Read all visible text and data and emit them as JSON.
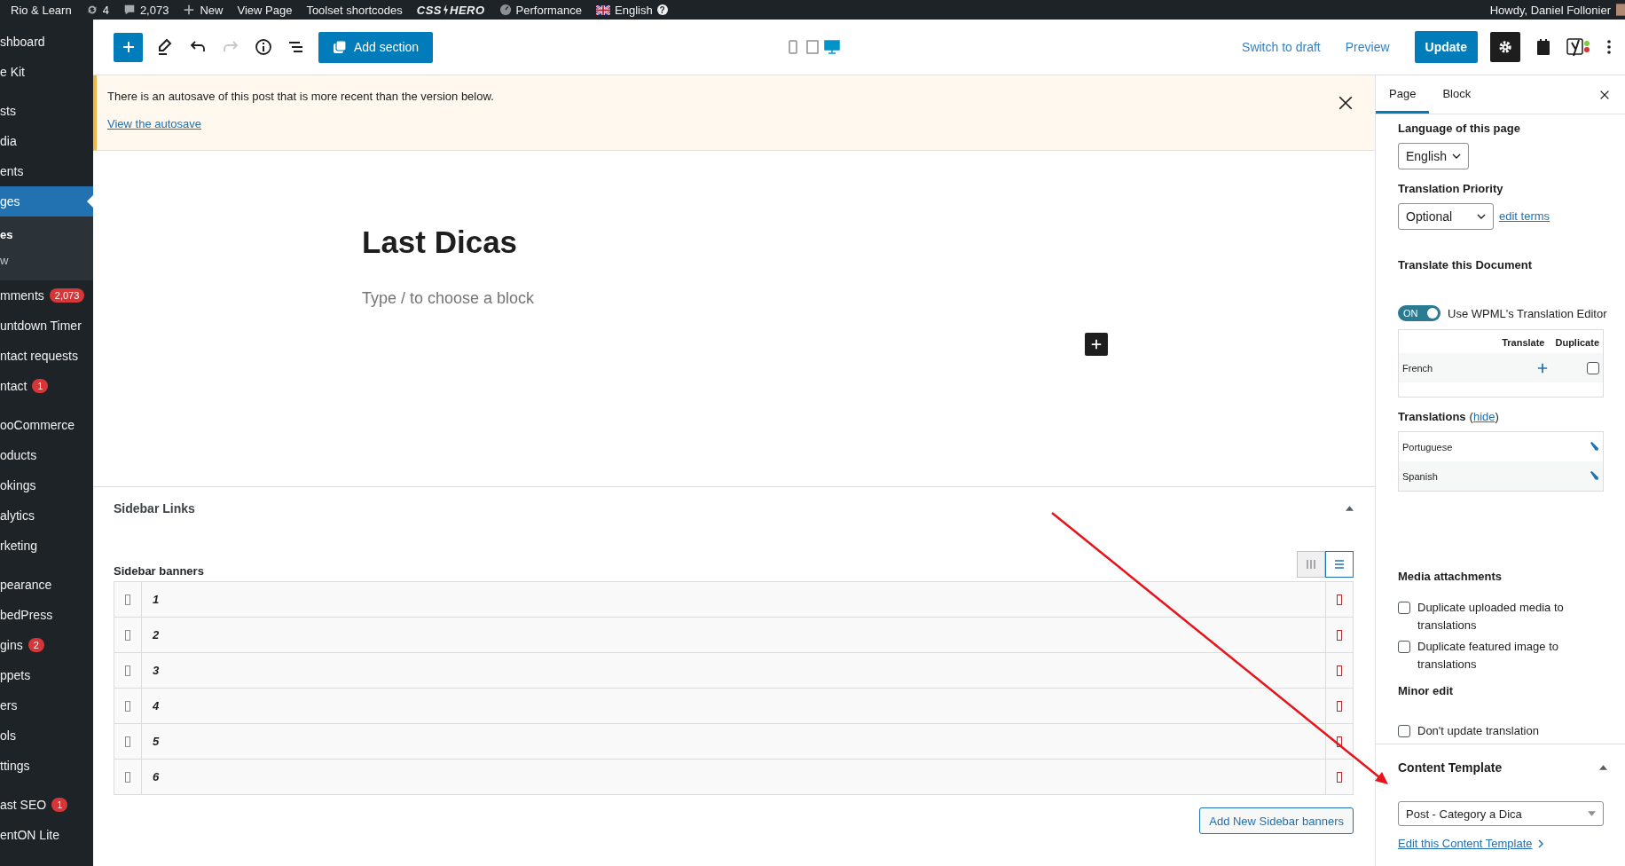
{
  "admin_bar": {
    "site": "Rio & Learn",
    "updates": "4",
    "comments": "2,073",
    "new": "New",
    "links": [
      "View Page",
      "Toolset shortcodes"
    ],
    "css_hero": {
      "left": "CSS",
      "right": "HERO"
    },
    "performance": "Performance",
    "language": "English",
    "help": "?",
    "greeting": "Howdy, Daniel Follonier"
  },
  "sidebar": {
    "groups": [
      [
        {
          "label": "shboard",
          "selected": false
        },
        {
          "label": "e Kit",
          "selected": false
        }
      ],
      [
        {
          "label": "sts",
          "selected": false
        },
        {
          "label": "dia",
          "selected": false
        },
        {
          "label": "ents",
          "selected": false
        },
        {
          "label": "ges",
          "selected": true,
          "children": [
            {
              "label": "es",
              "selected": true
            },
            {
              "label": "w",
              "selected": false
            }
          ]
        },
        {
          "label": "mments",
          "selected": false,
          "badge": "2,073"
        },
        {
          "label": "untdown Timer",
          "selected": false
        },
        {
          "label": "ntact requests",
          "selected": false
        },
        {
          "label": "ntact",
          "selected": false,
          "badge": "1"
        }
      ],
      [
        {
          "label": "ooCommerce",
          "selected": false
        },
        {
          "label": "oducts",
          "selected": false
        },
        {
          "label": "okings",
          "selected": false
        },
        {
          "label": "alytics",
          "selected": false
        },
        {
          "label": "rketing",
          "selected": false
        }
      ],
      [
        {
          "label": "pearance",
          "selected": false
        },
        {
          "label": "bedPress",
          "selected": false
        },
        {
          "label": "gins",
          "selected": false,
          "badge": "2"
        },
        {
          "label": "ppets",
          "selected": false
        },
        {
          "label": "ers",
          "selected": false
        },
        {
          "label": "ols",
          "selected": false
        },
        {
          "label": "ttings",
          "selected": false
        }
      ],
      [
        {
          "label": "ast SEO",
          "selected": false,
          "badge": "1"
        },
        {
          "label": "entON Lite",
          "selected": false
        }
      ]
    ]
  },
  "toolbar": {
    "redo": {
      "disabled": true
    },
    "add_section": "Add section",
    "devices": [
      {
        "kind": "mobile",
        "selected": false
      },
      {
        "kind": "tablet",
        "selected": false
      },
      {
        "kind": "desktop",
        "selected": true
      }
    ],
    "switch_to_draft": "Switch to draft",
    "preview": "Preview",
    "update": "Update",
    "settings": {
      "selected": true
    }
  },
  "notice": {
    "text": "There is an autosave of this post that is more recent than the version below.",
    "link": "View the autosave"
  },
  "editor": {
    "title": "Last Dicas",
    "placeholder": "Type / to choose a block"
  },
  "metabox": {
    "title": "Sidebar Links",
    "field_label": "Sidebar banners",
    "view_toggles": [
      {
        "kind": "columns",
        "selected": false
      },
      {
        "kind": "rows",
        "selected": true
      }
    ],
    "rows": [
      {
        "label": "1"
      },
      {
        "label": "2"
      },
      {
        "label": "3"
      },
      {
        "label": "4"
      },
      {
        "label": "5"
      },
      {
        "label": "6"
      }
    ],
    "add_button": "Add New Sidebar banners"
  },
  "panel": {
    "tabs": [
      {
        "label": "Page",
        "selected": true
      },
      {
        "label": "Block",
        "selected": false
      }
    ],
    "language_label": "Language of this page",
    "language": "English",
    "priority_label": "Translation Priority",
    "priority": "Optional",
    "edit_terms": "edit terms",
    "translate_heading": "Translate this Document",
    "editor_toggle": {
      "on": true,
      "text": "ON",
      "label": "Use WPML's Translation Editor"
    },
    "translate_table": {
      "columns": [
        "Translate",
        "Duplicate"
      ],
      "rows": [
        {
          "language": "French",
          "duplicate": false
        }
      ]
    },
    "translations": {
      "label": "Translations",
      "open": "(",
      "hide": "hide",
      "close": ")",
      "rows": [
        "Portuguese",
        "Spanish"
      ]
    },
    "media_heading": "Media attachments",
    "media_options": [
      {
        "label": "Duplicate uploaded media to translations",
        "checked": false
      },
      {
        "label": "Duplicate featured image to translations",
        "checked": false
      }
    ],
    "minor_heading": "Minor edit",
    "minor_options": [
      {
        "label": "Don't update translation",
        "checked": false
      }
    ],
    "content_template": {
      "title": "Content Template",
      "value": "Post - Category a Dica",
      "edit_link": "Edit this Content Template"
    }
  }
}
